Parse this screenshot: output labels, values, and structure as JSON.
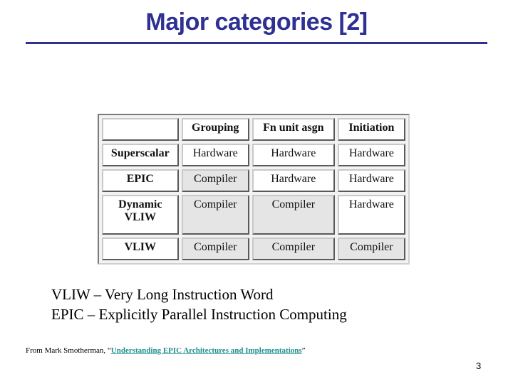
{
  "slide": {
    "title": "Major categories [2]",
    "page_number": "3"
  },
  "table": {
    "headers": [
      "",
      "Grouping",
      "Fn unit asgn",
      "Initiation"
    ],
    "rows": [
      {
        "label": "Superscalar",
        "cells": [
          "Hardware",
          "Hardware",
          "Hardware"
        ]
      },
      {
        "label": "EPIC",
        "cells": [
          "Compiler",
          "Hardware",
          "Hardware"
        ]
      },
      {
        "label": "Dynamic VLIW",
        "cells": [
          "Compiler",
          "Compiler",
          "Hardware"
        ]
      },
      {
        "label": "VLIW",
        "cells": [
          "Compiler",
          "Compiler",
          "Compiler"
        ]
      }
    ]
  },
  "definitions": [
    "VLIW – Very Long Instruction Word",
    "EPIC – Explicitly Parallel Instruction Computing"
  ],
  "source": {
    "prefix": "From Mark Smotherman, “",
    "link_text": "Understanding EPIC Architectures and Implementations",
    "suffix": "”"
  },
  "colors": {
    "title": "#2e3192",
    "link": "#1f8f8f",
    "compiler_cell": "#e5e5e5"
  }
}
